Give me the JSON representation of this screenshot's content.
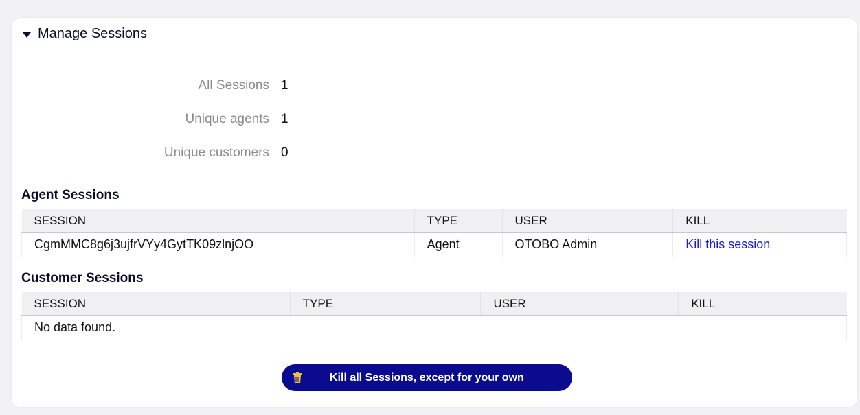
{
  "widget": {
    "title": "Manage Sessions"
  },
  "stats": [
    {
      "label": "All Sessions",
      "value": "1"
    },
    {
      "label": "Unique agents",
      "value": "1"
    },
    {
      "label": "Unique customers",
      "value": "0"
    }
  ],
  "agent_sessions": {
    "title": "Agent Sessions",
    "columns": [
      "SESSION",
      "TYPE",
      "USER",
      "KILL"
    ],
    "rows": [
      {
        "session": "CgmMMC8g6j3ujfrVYy4GytTK09zlnjOO",
        "type": "Agent",
        "user": "OTOBO Admin",
        "kill": "Kill this session"
      }
    ]
  },
  "customer_sessions": {
    "title": "Customer Sessions",
    "columns": [
      "SESSION",
      "TYPE",
      "USER",
      "KILL"
    ],
    "empty_text": "No data found."
  },
  "kill_all_button": {
    "label": "Kill all Sessions, except for your own",
    "icon": "trash-icon"
  },
  "colors": {
    "accent": "#0b0b8f",
    "link": "#1a1ad8"
  }
}
